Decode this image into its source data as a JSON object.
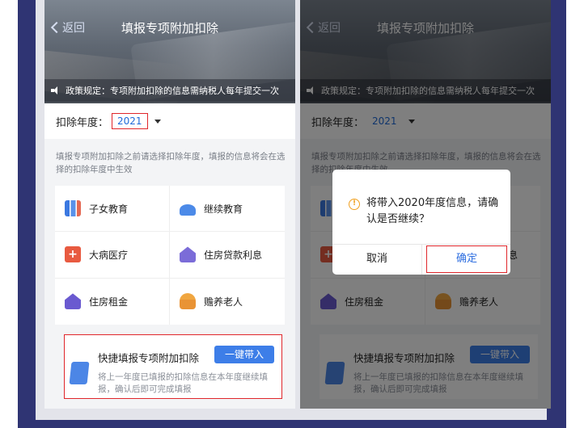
{
  "header": {
    "back_label": "返回",
    "title": "填报专项附加扣除"
  },
  "policy": {
    "text": "政策规定：专项附加扣除的信息需纳税人每年提交一次"
  },
  "year": {
    "label": "扣除年度：",
    "value": "2021"
  },
  "hint": "填报专项附加扣除之前请选择扣除年度，填报的信息将会在选择的扣除年度中生效",
  "categories": {
    "children": "子女教育",
    "continuing": "继续教育",
    "medical": "大病医疗",
    "loan": "住房贷款利息",
    "rent": "住房租金",
    "elderly": "赡养老人"
  },
  "quick": {
    "title": "快捷填报专项附加扣除",
    "button": "一键带入",
    "desc": "将上一年度已填报的扣除信息在本年度继续填报，确认后即可完成填报"
  },
  "dialog": {
    "warn_symbol": "!",
    "message": "将带入2020年度信息，请确认是否继续？",
    "cancel": "取消",
    "ok": "确定"
  },
  "colors": {
    "accent": "#3d7ee8",
    "highlight": "#e0262b",
    "frame": "#2f3473"
  }
}
